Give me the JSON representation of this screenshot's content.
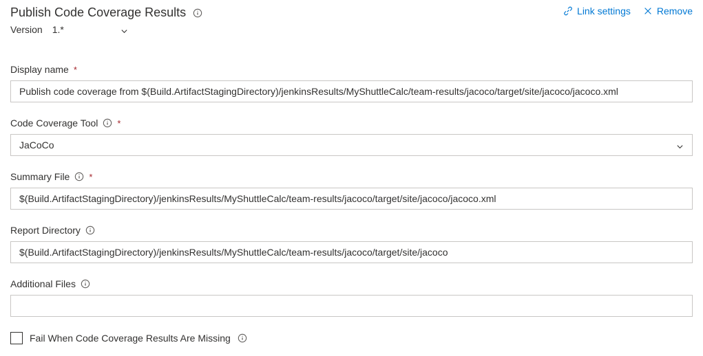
{
  "header": {
    "title": "Publish Code Coverage Results",
    "linkSettings": "Link settings",
    "remove": "Remove"
  },
  "version": {
    "label": "Version",
    "value": "1.*"
  },
  "fields": {
    "displayName": {
      "label": "Display name",
      "value": "Publish code coverage from $(Build.ArtifactStagingDirectory)/jenkinsResults/MyShuttleCalc/team-results/jacoco/target/site/jacoco/jacoco.xml"
    },
    "codeCoverageTool": {
      "label": "Code Coverage Tool",
      "value": "JaCoCo"
    },
    "summaryFile": {
      "label": "Summary File",
      "value": "$(Build.ArtifactStagingDirectory)/jenkinsResults/MyShuttleCalc/team-results/jacoco/target/site/jacoco/jacoco.xml"
    },
    "reportDirectory": {
      "label": "Report Directory",
      "value": "$(Build.ArtifactStagingDirectory)/jenkinsResults/MyShuttleCalc/team-results/jacoco/target/site/jacoco"
    },
    "additionalFiles": {
      "label": "Additional Files",
      "value": ""
    },
    "failWhenMissing": {
      "label": "Fail When Code Coverage Results Are Missing"
    }
  }
}
